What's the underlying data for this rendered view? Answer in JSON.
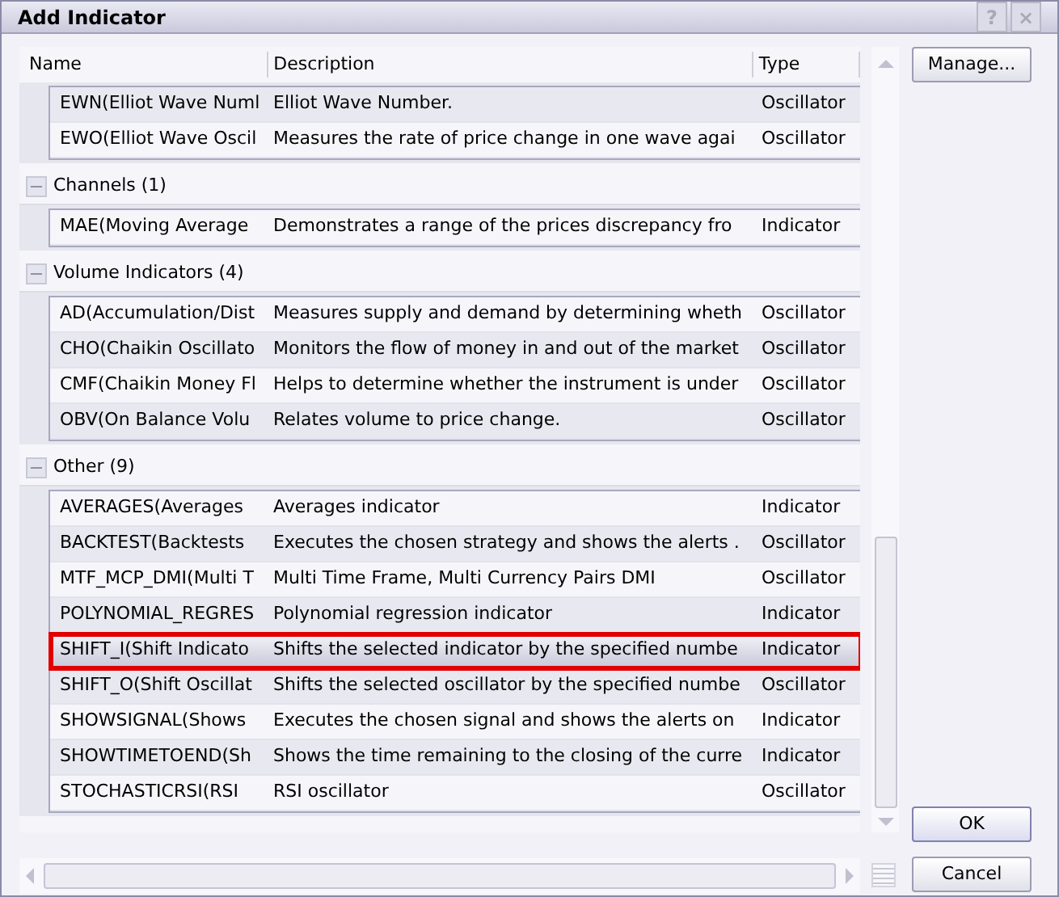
{
  "window": {
    "title": "Add Indicator",
    "controls": [
      "?",
      "×"
    ]
  },
  "table": {
    "columns": [
      "Name",
      "Description",
      "Type"
    ],
    "groups": [
      {
        "rows": [
          {
            "name": "EWN(Elliot Wave Numl",
            "description": "Elliot Wave Number.",
            "type": "Oscillator",
            "selected": false
          },
          {
            "name": "EWO(Elliot Wave Oscil",
            "description": "Measures the rate of price change in one wave agai",
            "type": "Oscillator",
            "selected": false
          }
        ]
      },
      {
        "title": "Channels (1)",
        "expanded": true,
        "rows": [
          {
            "name": "MAE(Moving Average",
            "description": "Demonstrates a range of the prices discrepancy fro",
            "type": "Indicator",
            "selected": false
          }
        ]
      },
      {
        "title": "Volume Indicators (4)",
        "expanded": true,
        "rows": [
          {
            "name": "AD(Accumulation/Dist",
            "description": "Measures supply and demand by determining wheth",
            "type": "Oscillator",
            "selected": false
          },
          {
            "name": "CHO(Chaikin Oscillato",
            "description": "Monitors the flow of money in and out of the market",
            "type": "Oscillator",
            "selected": false
          },
          {
            "name": "CMF(Chaikin Money Fl",
            "description": "Helps to determine whether the instrument is under",
            "type": "Oscillator",
            "selected": false
          },
          {
            "name": "OBV(On Balance Volu",
            "description": "Relates volume to price change.",
            "type": "Oscillator",
            "selected": false
          }
        ]
      },
      {
        "title": "Other (9)",
        "expanded": true,
        "rows": [
          {
            "name": "AVERAGES(Averages",
            "description": "Averages indicator",
            "type": "Indicator",
            "selected": false
          },
          {
            "name": "BACKTEST(Backtests",
            "description": "Executes the chosen strategy and shows the alerts .",
            "type": "Oscillator",
            "selected": false
          },
          {
            "name": "MTF_MCP_DMI(Multi T",
            "description": "Multi Time Frame, Multi Currency Pairs DMI",
            "type": "Oscillator",
            "selected": false
          },
          {
            "name": "POLYNOMIAL_REGRES",
            "description": "Polynomial regression indicator",
            "type": "Indicator",
            "selected": false
          },
          {
            "name": "SHIFT_I(Shift Indicato",
            "description": "Shifts the selected indicator by the specified numbe",
            "type": "Indicator",
            "selected": true
          },
          {
            "name": "SHIFT_O(Shift Oscillat",
            "description": "Shifts the selected oscillator by the specified numbe",
            "type": "Oscillator",
            "selected": false
          },
          {
            "name": "SHOWSIGNAL(Shows",
            "description": "Executes the chosen signal and shows the alerts on",
            "type": "Indicator",
            "selected": false
          },
          {
            "name": "SHOWTIMETOEND(Sh",
            "description": "Shows the time remaining to the closing of the curre",
            "type": "Indicator",
            "selected": false
          },
          {
            "name": "STOCHASTICRSI(RSI",
            "description": "RSI oscillator",
            "type": "Oscillator",
            "selected": false
          }
        ]
      }
    ]
  },
  "buttons": {
    "manage": "Manage...",
    "ok": "OK",
    "cancel": "Cancel"
  }
}
